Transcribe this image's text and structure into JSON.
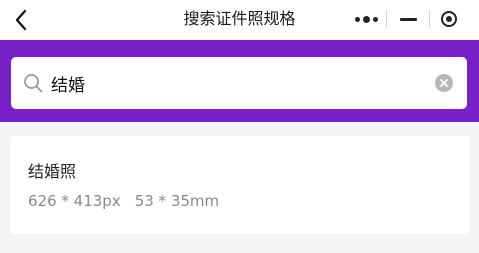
{
  "nav": {
    "title": "搜索证件照规格",
    "back_icon": "chevron-left-icon",
    "more_icon": "more-dots-icon",
    "minimize_icon": "minimize-icon",
    "close_icon": "target-circle-icon"
  },
  "colors": {
    "accent": "#7a20c8",
    "page_background": "#f5f5f7",
    "clear_button": "#b8b8b8",
    "spec_text": "#8a8a8a"
  },
  "search": {
    "value": "结婚",
    "placeholder": "",
    "search_icon": "search-icon",
    "clear_icon": "clear-circle-icon"
  },
  "results": [
    {
      "name": "结婚照",
      "pixel_size": "626 * 413px",
      "mm_size": "53 * 35mm"
    }
  ]
}
